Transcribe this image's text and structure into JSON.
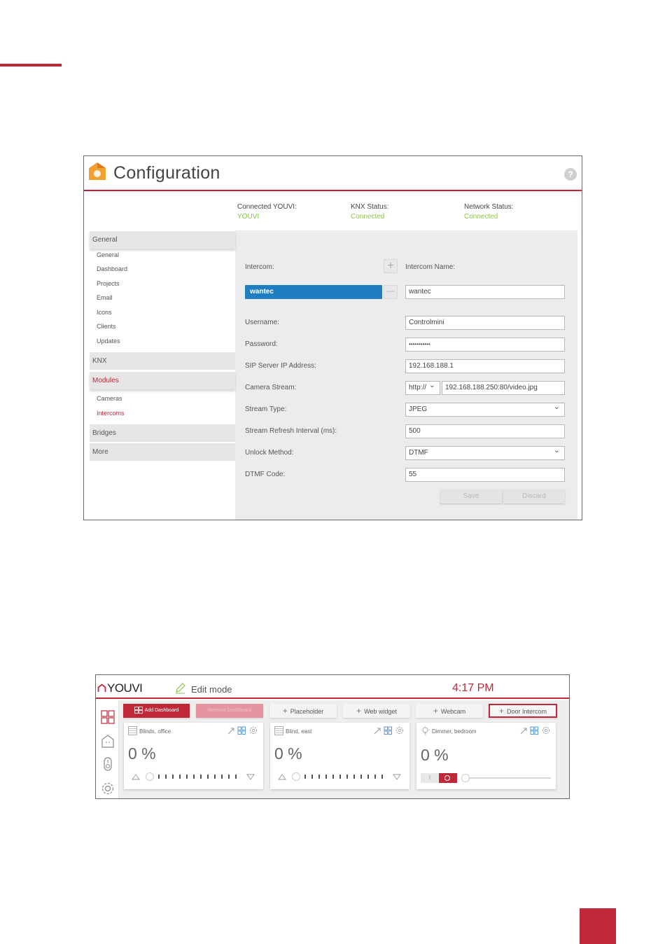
{
  "page": {
    "accent_color": "#c0283a"
  },
  "config": {
    "title": "Configuration",
    "help_icon": "?",
    "status": [
      {
        "label": "Connected YOUVI:",
        "value": "YOUVI"
      },
      {
        "label": "KNX Status:",
        "value": "Connected"
      },
      {
        "label": "Network Status:",
        "value": "Connected"
      }
    ],
    "status_value_color": "#8bc34a",
    "sidebar": {
      "general": {
        "label": "General",
        "items": [
          "General",
          "Dashboard",
          "Projects",
          "Email",
          "Icons",
          "Clients",
          "Updates"
        ]
      },
      "knx": {
        "label": "KNX"
      },
      "modules": {
        "label": "Modules",
        "items": [
          "Cameras",
          "Intercoms"
        ]
      },
      "bridges": {
        "label": "Bridges"
      },
      "more": {
        "label": "More"
      }
    },
    "form": {
      "intercom_label": "Intercom:",
      "intercom_selected": "wantec",
      "add_symbol": "+",
      "remove_symbol": "—",
      "intercom_name_label": "Intercom Name:",
      "intercom_name": "wantec",
      "username_label": "Username:",
      "username": "Controlmini",
      "password_label": "Password:",
      "password": "•••••••••••",
      "sip_label": "SIP Server IP Address:",
      "sip": "192.168.188.1",
      "camera_label": "Camera Stream:",
      "camera_protocol": "http://",
      "camera_url": "192.168.188.250:80/video.jpg",
      "stream_type_label": "Stream Type:",
      "stream_type": "JPEG",
      "refresh_label": "Stream Refresh Interval (ms):",
      "refresh": "500",
      "unlock_label": "Unlock Method:",
      "unlock": "DTMF",
      "dtmf_label": "DTMF Code:",
      "dtmf": "55",
      "save": "Save",
      "discard": "Discard"
    }
  },
  "dashboard": {
    "brand": "YOUVI",
    "edit_mode": "Edit mode",
    "time": "4:17 PM",
    "toolbar": {
      "add_dashboard": "Add Dashboard",
      "remove_dashboard": "Remove Dashboard",
      "placeholder": "Placeholder",
      "web_widget": "Web widget",
      "webcam": "Webcam",
      "door_intercom": "Door Intercom"
    },
    "widgets": [
      {
        "name": "Blinds, office",
        "value": "0 %",
        "icon": "blinds-icon"
      },
      {
        "name": "Blind, east",
        "value": "0 %",
        "icon": "blinds-icon"
      },
      {
        "name": "Dimmer, bedroom",
        "value": "0 %",
        "icon": "bulb-icon",
        "toggle_off": "I"
      }
    ]
  }
}
